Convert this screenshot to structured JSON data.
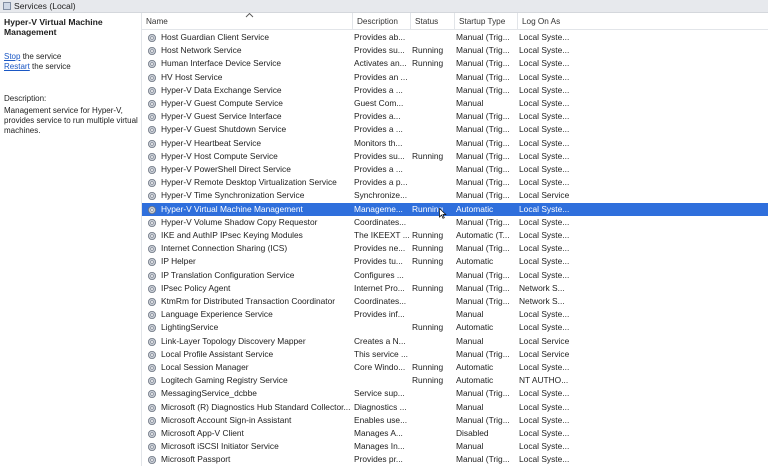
{
  "window": {
    "title": "Services (Local)"
  },
  "left_pane": {
    "service_name": "Hyper-V Virtual Machine Management",
    "stop_link": "Stop",
    "stop_rest": " the service",
    "restart_link": "Restart",
    "restart_rest": " the service",
    "description_label": "Description:",
    "description_text": "Management service for Hyper-V, provides service to run multiple virtual machines."
  },
  "columns": [
    "Name",
    "Description",
    "Status",
    "Startup Type",
    "Log On As"
  ],
  "colors": {
    "selection": "#2f6fdc",
    "link": "#1a57c4",
    "header_bg": "#e7e9ed"
  },
  "icons": {
    "service": "gear-icon",
    "sort": "sort-ascending-icon",
    "cursor": "mouse-pointer-icon"
  },
  "rows": [
    {
      "name": "Host Guardian Client Service",
      "desc": "Provides ab...",
      "status": "",
      "startup": "Manual (Trig...",
      "logon": "Local Syste..."
    },
    {
      "name": "Host Network Service",
      "desc": "Provides su...",
      "status": "Running",
      "startup": "Manual (Trig...",
      "logon": "Local Syste..."
    },
    {
      "name": "Human Interface Device Service",
      "desc": "Activates an...",
      "status": "Running",
      "startup": "Manual (Trig...",
      "logon": "Local Syste..."
    },
    {
      "name": "HV Host Service",
      "desc": "Provides an ...",
      "status": "",
      "startup": "Manual (Trig...",
      "logon": "Local Syste..."
    },
    {
      "name": "Hyper-V Data Exchange Service",
      "desc": "Provides a ...",
      "status": "",
      "startup": "Manual (Trig...",
      "logon": "Local Syste..."
    },
    {
      "name": "Hyper-V Guest Compute Service",
      "desc": "Guest Com...",
      "status": "",
      "startup": "Manual",
      "logon": "Local Syste..."
    },
    {
      "name": "Hyper-V Guest Service Interface",
      "desc": "Provides a...",
      "status": "",
      "startup": "Manual (Trig...",
      "logon": "Local Syste..."
    },
    {
      "name": "Hyper-V Guest Shutdown Service",
      "desc": "Provides a ...",
      "status": "",
      "startup": "Manual (Trig...",
      "logon": "Local Syste..."
    },
    {
      "name": "Hyper-V Heartbeat Service",
      "desc": "Monitors th...",
      "status": "",
      "startup": "Manual (Trig...",
      "logon": "Local Syste..."
    },
    {
      "name": "Hyper-V Host Compute Service",
      "desc": "Provides su...",
      "status": "Running",
      "startup": "Manual (Trig...",
      "logon": "Local Syste..."
    },
    {
      "name": "Hyper-V PowerShell Direct Service",
      "desc": "Provides a ...",
      "status": "",
      "startup": "Manual (Trig...",
      "logon": "Local Syste..."
    },
    {
      "name": "Hyper-V Remote Desktop Virtualization Service",
      "desc": "Provides a p...",
      "status": "",
      "startup": "Manual (Trig...",
      "logon": "Local Syste..."
    },
    {
      "name": "Hyper-V Time Synchronization Service",
      "desc": "Synchronize...",
      "status": "",
      "startup": "Manual (Trig...",
      "logon": "Local Service"
    },
    {
      "name": "Hyper-V Virtual Machine Management",
      "desc": "Manageme...",
      "status": "Running",
      "startup": "Automatic",
      "logon": "Local Syste...",
      "selected": true
    },
    {
      "name": "Hyper-V Volume Shadow Copy Requestor",
      "desc": "Coordinates...",
      "status": "",
      "startup": "Manual (Trig...",
      "logon": "Local Syste..."
    },
    {
      "name": "IKE and AuthIP IPsec Keying Modules",
      "desc": "The IKEEXT ...",
      "status": "Running",
      "startup": "Automatic (T...",
      "logon": "Local Syste..."
    },
    {
      "name": "Internet Connection Sharing (ICS)",
      "desc": "Provides ne...",
      "status": "Running",
      "startup": "Manual (Trig...",
      "logon": "Local Syste..."
    },
    {
      "name": "IP Helper",
      "desc": "Provides tu...",
      "status": "Running",
      "startup": "Automatic",
      "logon": "Local Syste..."
    },
    {
      "name": "IP Translation Configuration Service",
      "desc": "Configures ...",
      "status": "",
      "startup": "Manual (Trig...",
      "logon": "Local Syste..."
    },
    {
      "name": "IPsec Policy Agent",
      "desc": "Internet Pro...",
      "status": "Running",
      "startup": "Manual (Trig...",
      "logon": "Network S..."
    },
    {
      "name": "KtmRm for Distributed Transaction Coordinator",
      "desc": "Coordinates...",
      "status": "",
      "startup": "Manual (Trig...",
      "logon": "Network S..."
    },
    {
      "name": "Language Experience Service",
      "desc": "Provides inf...",
      "status": "",
      "startup": "Manual",
      "logon": "Local Syste..."
    },
    {
      "name": "LightingService",
      "desc": "",
      "status": "Running",
      "startup": "Automatic",
      "logon": "Local Syste..."
    },
    {
      "name": "Link-Layer Topology Discovery Mapper",
      "desc": "Creates a N...",
      "status": "",
      "startup": "Manual",
      "logon": "Local Service"
    },
    {
      "name": "Local Profile Assistant Service",
      "desc": "This service ...",
      "status": "",
      "startup": "Manual (Trig...",
      "logon": "Local Service"
    },
    {
      "name": "Local Session Manager",
      "desc": "Core Windo...",
      "status": "Running",
      "startup": "Automatic",
      "logon": "Local Syste..."
    },
    {
      "name": "Logitech Gaming Registry Service",
      "desc": "",
      "status": "Running",
      "startup": "Automatic",
      "logon": "NT AUTHO..."
    },
    {
      "name": "MessagingService_dcbbe",
      "desc": "Service sup...",
      "status": "",
      "startup": "Manual (Trig...",
      "logon": "Local Syste..."
    },
    {
      "name": "Microsoft (R) Diagnostics Hub Standard Collector...",
      "desc": "Diagnostics ...",
      "status": "",
      "startup": "Manual",
      "logon": "Local Syste..."
    },
    {
      "name": "Microsoft Account Sign-in Assistant",
      "desc": "Enables use...",
      "status": "",
      "startup": "Manual (Trig...",
      "logon": "Local Syste..."
    },
    {
      "name": "Microsoft App-V Client",
      "desc": "Manages A...",
      "status": "",
      "startup": "Disabled",
      "logon": "Local Syste..."
    },
    {
      "name": "Microsoft iSCSI Initiator Service",
      "desc": "Manages In...",
      "status": "",
      "startup": "Manual",
      "logon": "Local Syste..."
    },
    {
      "name": "Microsoft Passport",
      "desc": "Provides pr...",
      "status": "",
      "startup": "Manual (Trig...",
      "logon": "Local Syste..."
    }
  ]
}
